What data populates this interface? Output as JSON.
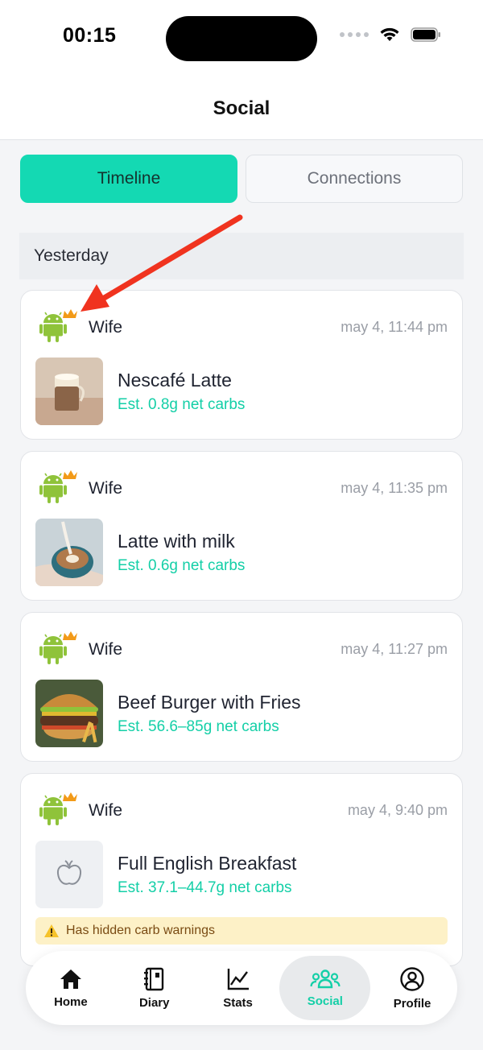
{
  "status_bar": {
    "time": "00:15"
  },
  "nav": {
    "title": "Social"
  },
  "segmented": {
    "timeline": "Timeline",
    "connections": "Connections"
  },
  "section": {
    "yesterday": "Yesterday"
  },
  "feed": [
    {
      "user": "Wife",
      "time": "may 4, 11:44 pm",
      "food": "Nescafé Latte",
      "carbs": "Est. 0.8g net carbs"
    },
    {
      "user": "Wife",
      "time": "may 4, 11:35 pm",
      "food": "Latte with milk",
      "carbs": "Est. 0.6g net carbs"
    },
    {
      "user": "Wife",
      "time": "may 4, 11:27 pm",
      "food": "Beef Burger with Fries",
      "carbs": "Est. 56.6–85g net carbs"
    },
    {
      "user": "Wife",
      "time": "may 4, 9:40 pm",
      "food": "Full English Breakfast",
      "carbs": "Est. 37.1–44.7g net carbs",
      "warning": "Has hidden carb warnings"
    }
  ],
  "tabs": [
    {
      "label": "Home",
      "icon": "home-icon"
    },
    {
      "label": "Diary",
      "icon": "notebook-icon"
    },
    {
      "label": "Stats",
      "icon": "line-chart-icon"
    },
    {
      "label": "Social",
      "icon": "people-icon"
    },
    {
      "label": "Profile",
      "icon": "user-circle-icon"
    }
  ],
  "colors": {
    "accent": "#14d9b3",
    "accent_text": "#14cfa7",
    "annotation_arrow": "#f0331f",
    "android_green": "#8fc33a",
    "crown_orange": "#f29a18"
  }
}
